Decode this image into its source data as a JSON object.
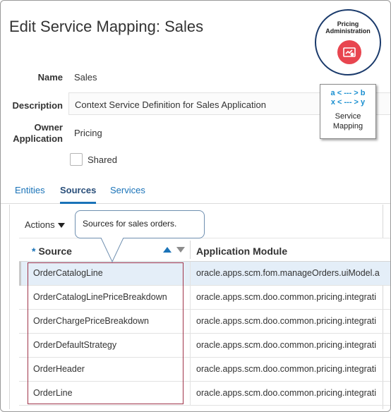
{
  "page": {
    "title": "Edit Service Mapping: Sales"
  },
  "badge": {
    "title_line1": "Pricing",
    "title_line2": "Administration",
    "icon": "pricing-admin-icon",
    "color": "#e8454f"
  },
  "form": {
    "name_label": "Name",
    "name_value": "Sales",
    "description_label": "Description",
    "description_value": "Context Service Definition for Sales Application",
    "owner_label_line1": "Owner",
    "owner_label_line2": "Application",
    "owner_value": "Pricing",
    "shared_label": "Shared"
  },
  "callout": {
    "line1": "a < --- > b",
    "line2": "x < --- > y",
    "caption_line1": "Service",
    "caption_line2": "Mapping"
  },
  "tabs": [
    {
      "label": "Entities",
      "active": false
    },
    {
      "label": "Sources",
      "active": true
    },
    {
      "label": "Services",
      "active": false
    }
  ],
  "toolbar": {
    "actions_label": "Actions"
  },
  "tooltip": {
    "text": "Sources for sales orders."
  },
  "table": {
    "columns": [
      {
        "label": "Source",
        "required": "*"
      },
      {
        "label": "Application Module"
      }
    ],
    "rows": [
      {
        "source": "OrderCatalogLine",
        "module": "oracle.apps.scm.fom.manageOrders.uiModel.a",
        "selected": true
      },
      {
        "source": "OrderCatalogLinePriceBreakdown",
        "module": "oracle.apps.scm.doo.common.pricing.integrati"
      },
      {
        "source": "OrderChargePriceBreakdown",
        "module": "oracle.apps.scm.doo.common.pricing.integrati"
      },
      {
        "source": "OrderDefaultStrategy",
        "module": "oracle.apps.scm.doo.common.pricing.integrati"
      },
      {
        "source": "OrderHeader",
        "module": "oracle.apps.scm.doo.common.pricing.integrati"
      },
      {
        "source": "OrderLine",
        "module": "oracle.apps.scm.doo.common.pricing.integrati"
      }
    ]
  },
  "colors": {
    "accent": "#1a73b8",
    "highlight_border": "#a0344a",
    "selected_row": "#e4eef8"
  }
}
